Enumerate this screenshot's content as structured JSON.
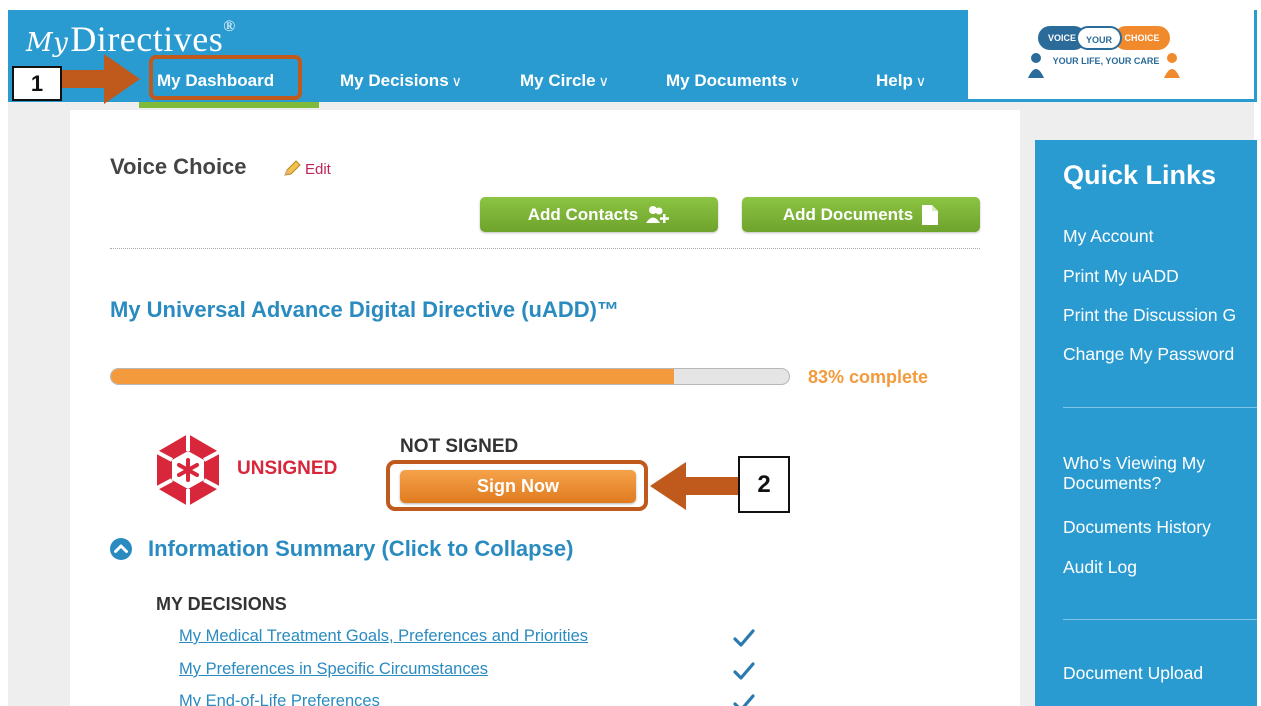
{
  "header": {
    "logo_prefix": "My",
    "logo_text": "Directives",
    "logo_mark": "®",
    "nav": [
      {
        "label": "My Dashboard",
        "has_chevron": false
      },
      {
        "label": "My Decisions",
        "has_chevron": true
      },
      {
        "label": "My Circle",
        "has_chevron": true
      },
      {
        "label": "My Documents",
        "has_chevron": true
      },
      {
        "label": "Help",
        "has_chevron": true
      }
    ],
    "chevron": "∨",
    "partner": {
      "word1": "VOICE",
      "word2": "YOUR",
      "word3": "CHOICE",
      "tagline": "YOUR LIFE, YOUR CARE"
    }
  },
  "profile": {
    "name": "Voice Choice",
    "edit_label": "Edit"
  },
  "actions": {
    "add_contacts": "Add Contacts",
    "add_documents": "Add Documents"
  },
  "uadd": {
    "title": "My Universal Advance Digital Directive (uADD)™",
    "progress_fraction": 0.83,
    "progress_label": "83% complete",
    "unsigned_label": "UNSIGNED",
    "status": "NOT SIGNED",
    "sign_button": "Sign Now"
  },
  "callouts": {
    "one": "1",
    "two": "2",
    "color": "#c0591c"
  },
  "summary": {
    "title": "Information Summary (Click to Collapse)",
    "section_heading": "MY DECISIONS",
    "items": [
      {
        "label": "My Medical Treatment Goals, Preferences and Priorities",
        "complete": true
      },
      {
        "label": "My Preferences in Specific Circumstances",
        "complete": true
      },
      {
        "label": "My End-of-Life Preferences",
        "complete": true
      }
    ]
  },
  "quick_links": {
    "title": "Quick Links",
    "group1": [
      "My Account",
      "Print My uADD",
      "Print the Discussion G",
      "Change My Password"
    ],
    "group2_multiline": "Who's Viewing My Documents?",
    "group2": [
      "Documents History",
      "Audit Log"
    ],
    "group3": [
      "Document Upload"
    ]
  },
  "colors": {
    "header_blue": "#2a9bd1",
    "link_blue": "#2a8bc0",
    "green": "#7fbb3a",
    "orange": "#f39a3c",
    "unsigned_red": "#d8263a",
    "edit_pink": "#c0245a"
  }
}
